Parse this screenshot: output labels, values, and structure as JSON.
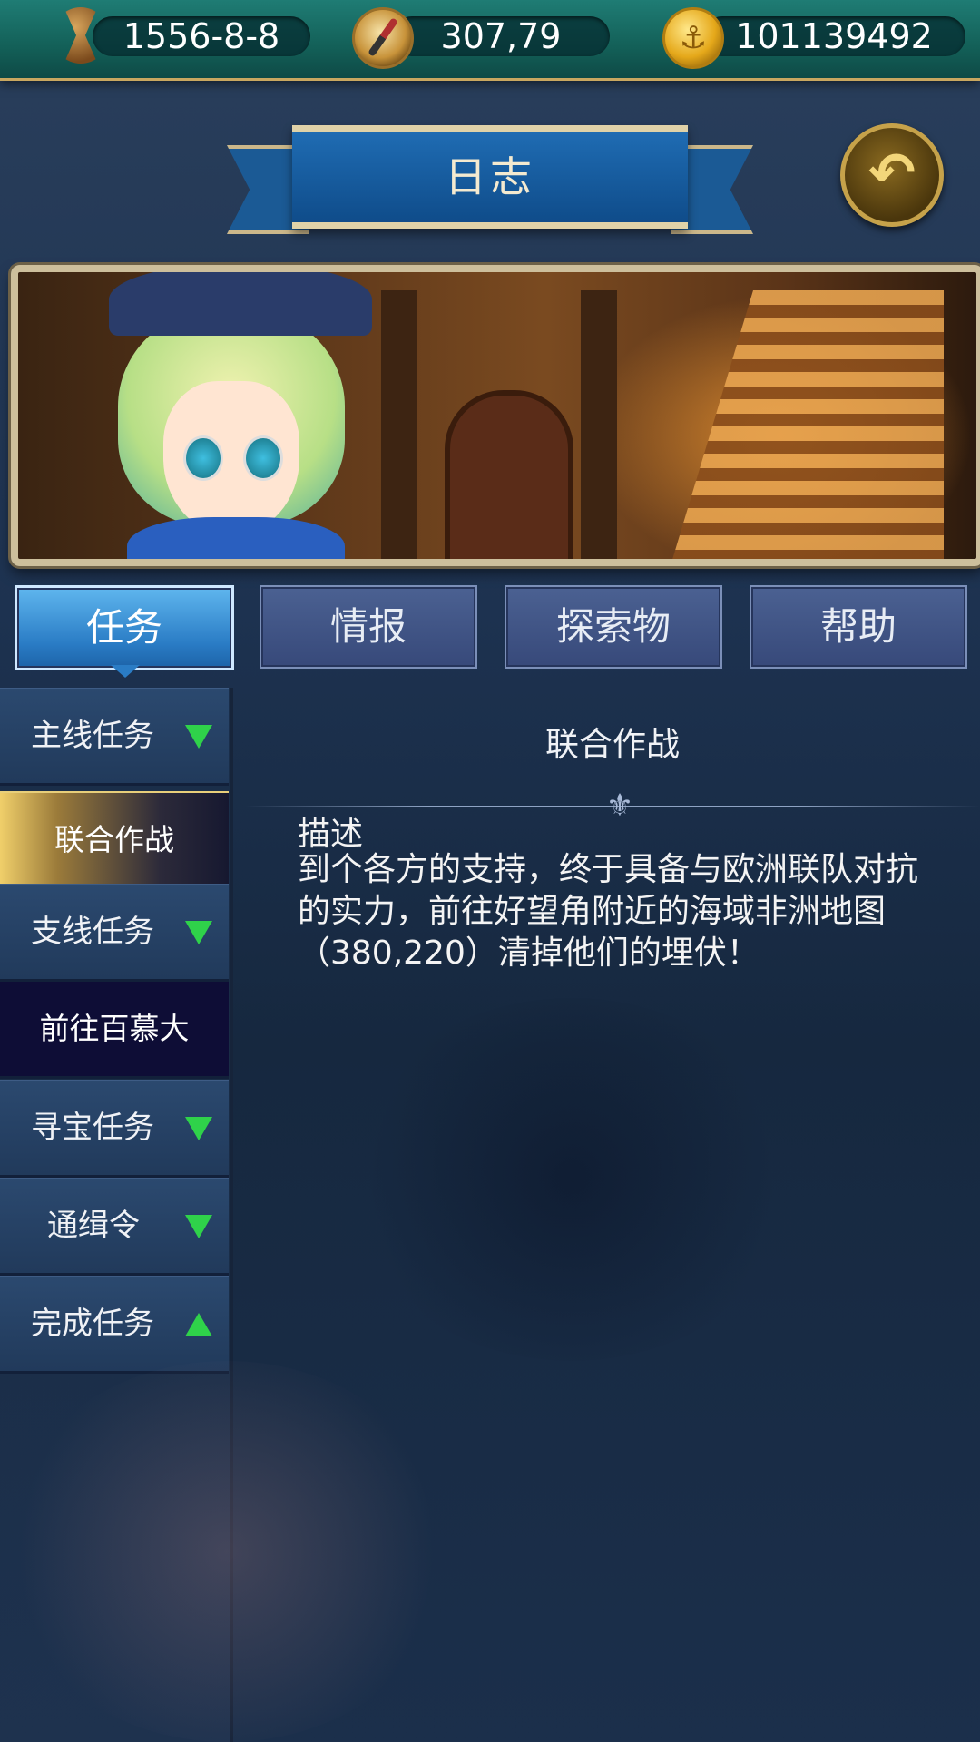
{
  "status_bar": {
    "date": "1556-8-8",
    "coords": "307,79",
    "gold": "101139492",
    "icons": [
      "hourglass-icon",
      "compass-icon",
      "anchor-coin-icon"
    ]
  },
  "header": {
    "title": "日志",
    "back_icon": "return-arrow-icon"
  },
  "tabs": [
    {
      "label": "任务",
      "active": true
    },
    {
      "label": "情报",
      "active": false
    },
    {
      "label": "探索物",
      "active": false
    },
    {
      "label": "帮助",
      "active": false
    }
  ],
  "sidebar": {
    "main_quest": "主线任务",
    "main_quest_item": "联合作战",
    "side_quest": "支线任务",
    "side_quest_item": "前往百慕大",
    "treasure_quest": "寻宝任务",
    "wanted": "通缉令",
    "completed": "完成任务"
  },
  "content": {
    "title": "联合作战",
    "desc_label": "描述",
    "desc_text": "到个各方的支持，终于具备与欧洲联队对抗的实力，前往好望角附近的海域非洲地图（380,220）清掉他们的埋伏！"
  },
  "colors": {
    "accent_gold": "#c9a760",
    "tab_active": "#2a7cc5",
    "arrow_green": "#2fd24a"
  }
}
